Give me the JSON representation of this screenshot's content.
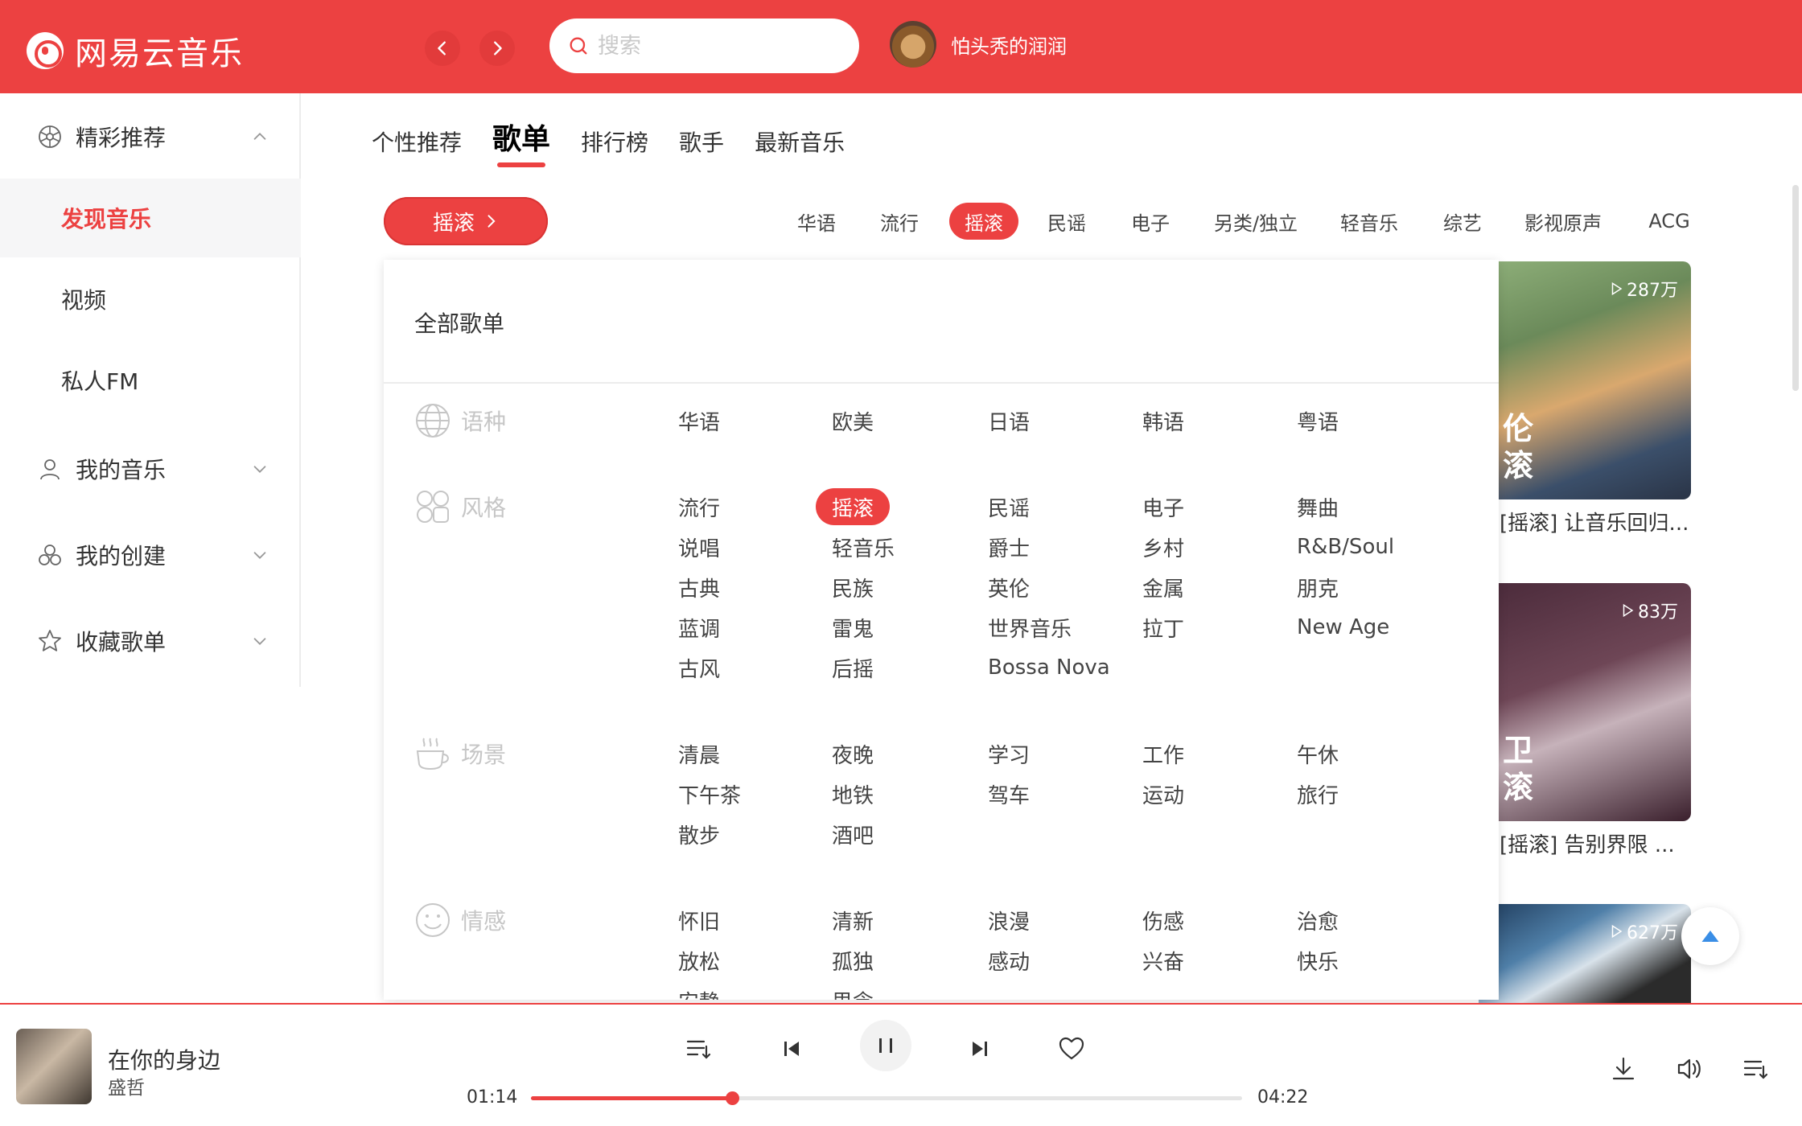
{
  "app": {
    "title": "网易云音乐"
  },
  "header": {
    "search_placeholder": "搜索",
    "user_name": "怕头秃的润润"
  },
  "sidebar": {
    "groups": [
      {
        "label": "精彩推荐",
        "icon": "recommend-icon",
        "expanded": true
      },
      {
        "label": "我的音乐",
        "icon": "user-icon",
        "expanded": false
      },
      {
        "label": "我的创建",
        "icon": "creation-icon",
        "expanded": false
      },
      {
        "label": "收藏歌单",
        "icon": "star-icon",
        "expanded": false
      }
    ],
    "items": [
      {
        "label": "发现音乐",
        "active": true
      },
      {
        "label": "视频",
        "active": false
      },
      {
        "label": "私人FM",
        "active": false
      }
    ]
  },
  "main": {
    "tabs": [
      {
        "label": "个性推荐",
        "active": false
      },
      {
        "label": "歌单",
        "active": true
      },
      {
        "label": "排行榜",
        "active": false
      },
      {
        "label": "歌手",
        "active": false
      },
      {
        "label": "最新音乐",
        "active": false
      }
    ],
    "category_button": "摇滚",
    "hot_tags": [
      {
        "label": "华语",
        "active": false
      },
      {
        "label": "流行",
        "active": false
      },
      {
        "label": "摇滚",
        "active": true
      },
      {
        "label": "民谣",
        "active": false
      },
      {
        "label": "电子",
        "active": false
      },
      {
        "label": "另类/独立",
        "active": false
      },
      {
        "label": "轻音乐",
        "active": false
      },
      {
        "label": "综艺",
        "active": false
      },
      {
        "label": "影视原声",
        "active": false
      },
      {
        "label": "ACG",
        "active": false
      }
    ],
    "panel": {
      "all_label": "全部歌单",
      "groups": [
        {
          "label": "语种",
          "icon": "globe-icon",
          "rows": [
            [
              "华语",
              "欧美",
              "日语",
              "韩语",
              "粤语"
            ]
          ]
        },
        {
          "label": "风格",
          "icon": "style-icon",
          "rows": [
            [
              "流行",
              "摇滚",
              "民谣",
              "电子",
              "舞曲"
            ],
            [
              "说唱",
              "轻音乐",
              "爵士",
              "乡村",
              "R&B/Soul"
            ],
            [
              "古典",
              "民族",
              "英伦",
              "金属",
              "朋克"
            ],
            [
              "蓝调",
              "雷鬼",
              "世界音乐",
              "拉丁",
              "New Age"
            ],
            [
              "古风",
              "后摇",
              "Bossa Nova"
            ]
          ]
        },
        {
          "label": "场景",
          "icon": "coffee-icon",
          "rows": [
            [
              "清晨",
              "夜晚",
              "学习",
              "工作",
              "午休"
            ],
            [
              "下午茶",
              "地铁",
              "驾车",
              "运动",
              "旅行"
            ],
            [
              "散步",
              "酒吧"
            ]
          ]
        },
        {
          "label": "情感",
          "icon": "smile-icon",
          "rows": [
            [
              "怀旧",
              "清新",
              "浪漫",
              "伤感",
              "治愈"
            ],
            [
              "放松",
              "孤独",
              "感动",
              "兴奋",
              "快乐"
            ],
            [
              "安静",
              "思念"
            ]
          ]
        }
      ],
      "selected": "摇滚"
    },
    "cards": [
      {
        "play_count": "287万",
        "caption": "[摇滚] 让音乐回归...",
        "cover_text": "伦\n滚"
      },
      {
        "play_count": "83万",
        "caption": "[摇滚] 告别界限 ...",
        "cover_text": "卫\n滚"
      },
      {
        "play_count": "627万",
        "caption": "",
        "cover_text": ""
      }
    ]
  },
  "player": {
    "song_title": "在你的身边",
    "artist": "盛哲",
    "current_time": "01:14",
    "total_time": "04:22",
    "progress": 0.2824
  },
  "colors": {
    "brand": "#ec4141",
    "sidebar_active_bg": "#f6f6f7"
  }
}
